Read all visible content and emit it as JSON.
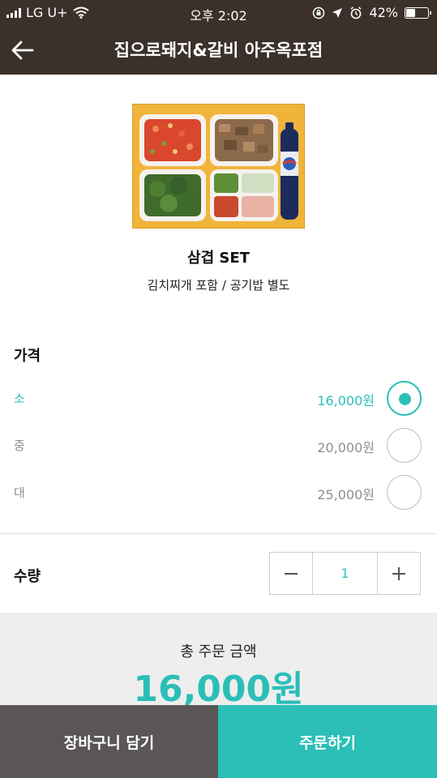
{
  "status_bar": {
    "carrier": "LG U+",
    "time": "오후 2:02",
    "battery_percent": "42%",
    "battery_level": 0.42,
    "icons": [
      "signal-icon",
      "wifi-icon",
      "rotation-lock-icon",
      "location-icon",
      "alarm-icon",
      "battery-icon"
    ]
  },
  "header": {
    "title": "집으로돼지&갈비 아주옥포점",
    "back_icon": "arrow-left-icon"
  },
  "product": {
    "name": "삼겹 SET",
    "description": "김치찌개 포함 / 공기밥 별도"
  },
  "price_section": {
    "heading": "가격",
    "options": [
      {
        "label": "소",
        "price": "16,000원",
        "selected": true
      },
      {
        "label": "중",
        "price": "20,000원",
        "selected": false
      },
      {
        "label": "대",
        "price": "25,000원",
        "selected": false
      }
    ]
  },
  "quantity": {
    "label": "수량",
    "value": "1"
  },
  "total": {
    "label": "총 주문 금액",
    "amount": "16,000원"
  },
  "actions": {
    "cart_label": "장바구니 담기",
    "order_label": "주문하기"
  },
  "colors": {
    "header_bg": "#3b312a",
    "accent": "#2bbfb7",
    "cart_bg": "#5a5656",
    "total_bg": "#eeeeee"
  }
}
